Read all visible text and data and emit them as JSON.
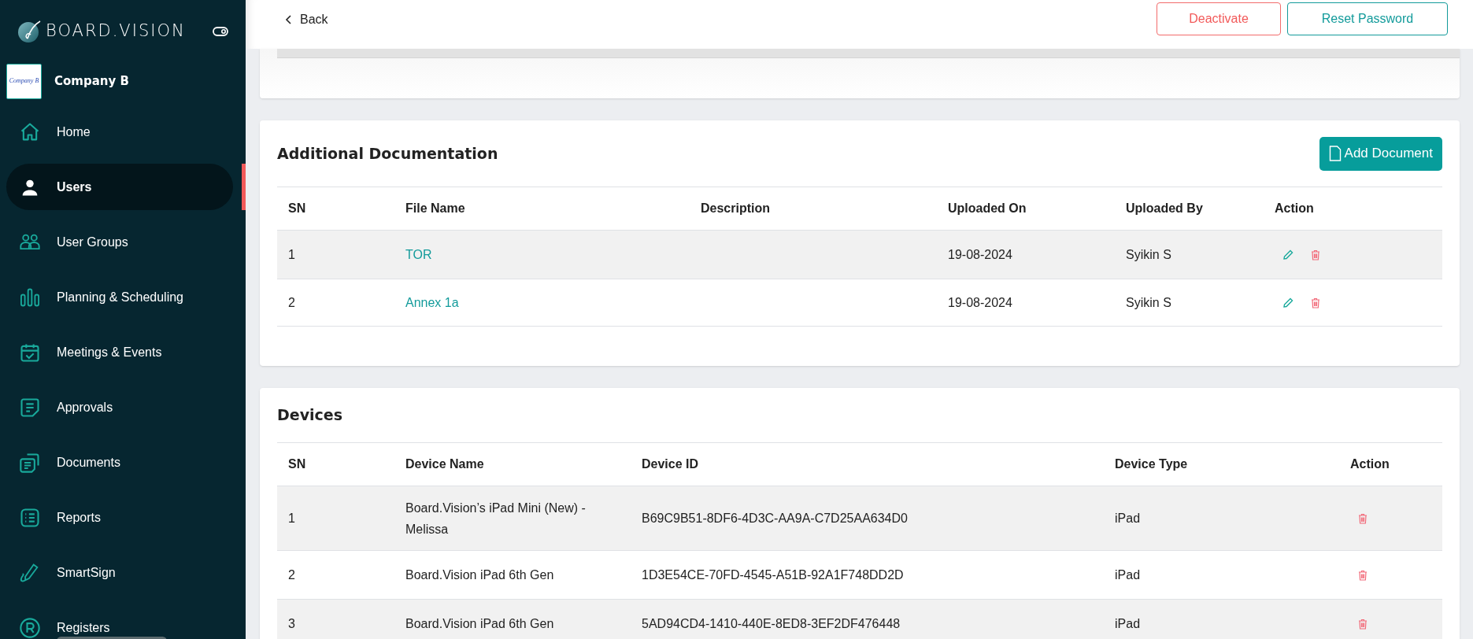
{
  "sidebar": {
    "brand": "BOARD.VISION",
    "company": {
      "name": "Company B",
      "logo_text": "Company B"
    },
    "items": [
      {
        "label": "Home",
        "selected": false
      },
      {
        "label": "Users",
        "selected": true
      },
      {
        "label": "User Groups",
        "selected": false
      },
      {
        "label": "Planning & Scheduling",
        "selected": false
      },
      {
        "label": "Meetings & Events",
        "selected": false
      },
      {
        "label": "Approvals",
        "selected": false
      },
      {
        "label": "Documents",
        "selected": false
      },
      {
        "label": "Reports",
        "selected": false
      },
      {
        "label": "SmartSign",
        "selected": false
      },
      {
        "label": "Registers",
        "selected": false
      }
    ]
  },
  "header": {
    "back": "Back",
    "buttons": [
      {
        "label": "Deactivate",
        "kind": "danger"
      },
      {
        "label": "Reset Password",
        "kind": "outline"
      }
    ]
  },
  "documentation": {
    "title": "Additional Documentation",
    "add_button": "Add Document",
    "columns": [
      "SN",
      "File Name",
      "Description",
      "Uploaded On",
      "Uploaded By",
      "Action"
    ],
    "rows": [
      {
        "sn": "1",
        "file_name": "TOR",
        "uploaded_on": "19-08-2024",
        "uploaded_by": "Syikin S"
      },
      {
        "sn": "2",
        "file_name": "Annex 1a",
        "uploaded_on": "19-08-2024",
        "uploaded_by": "Syikin S"
      }
    ]
  },
  "devices": {
    "title": "Devices",
    "columns": [
      "SN",
      "Device Name",
      "Device ID",
      "Device Type",
      "Action"
    ],
    "rows": [
      {
        "sn": "1",
        "device_name": "Board.Vision’s iPad Mini (New) - Melissa",
        "device_id": "B69C9B51-8DF6-4D3C-AA9A-C7D25AA634D0",
        "device_type": "iPad"
      },
      {
        "sn": "2",
        "device_name": "Board.Vision iPad 6th Gen",
        "device_id": "1D3E54CE-70FD-4545-A51B-92A1F748DD2D",
        "device_type": "iPad"
      },
      {
        "sn": "3",
        "device_name": "Board.Vision iPad 6th Gen",
        "device_id": "5AD94CD4-1410-440E-8ED8-3EF2DF476448",
        "device_type": "iPad"
      }
    ]
  }
}
